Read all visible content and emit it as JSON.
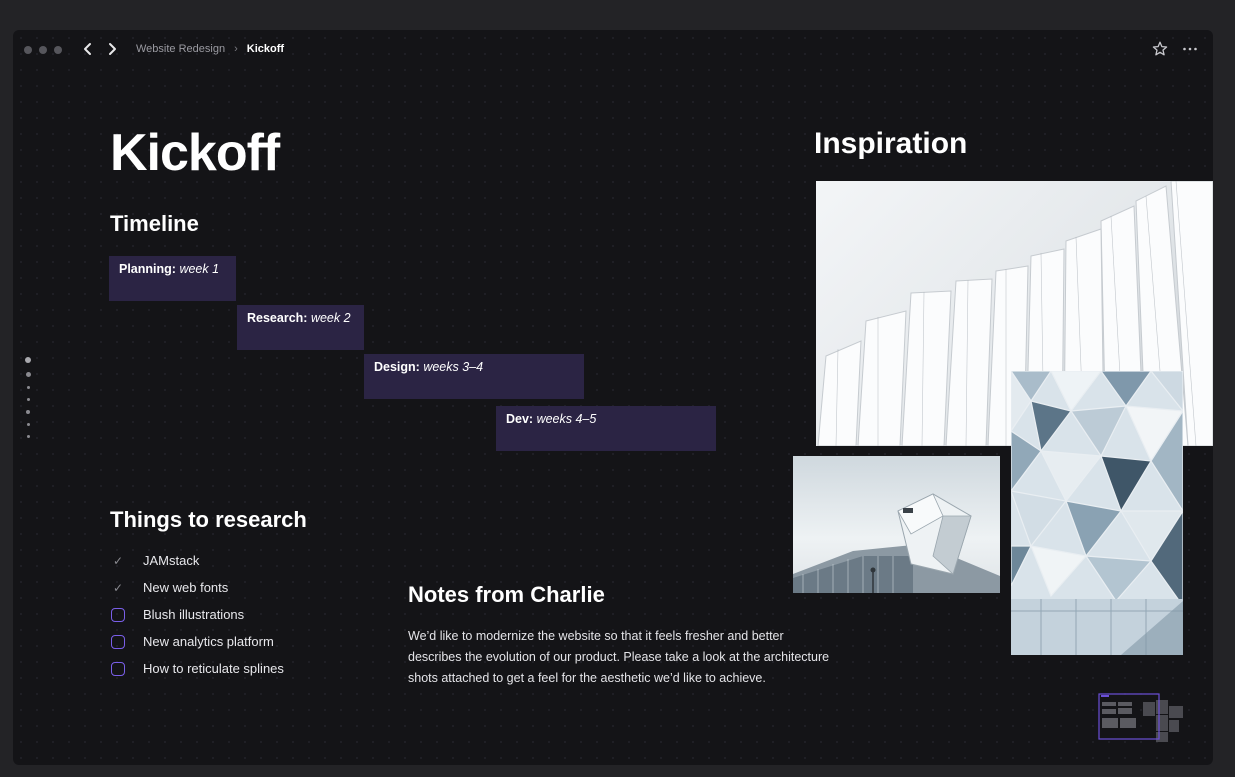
{
  "window": {
    "breadcrumb": {
      "parent": "Website Redesign",
      "separator": "›",
      "current": "Kickoff"
    }
  },
  "page": {
    "title": "Kickoff"
  },
  "timeline": {
    "heading": "Timeline",
    "phases": [
      {
        "label": "Planning:",
        "duration": "week 1"
      },
      {
        "label": "Research:",
        "duration": "week 2"
      },
      {
        "label": "Design:",
        "duration": "weeks 3–4"
      },
      {
        "label": "Dev:",
        "duration": "weeks 4–5"
      }
    ]
  },
  "research": {
    "heading": "Things to research",
    "items": [
      {
        "text": "JAMstack",
        "done": true
      },
      {
        "text": "New web fonts",
        "done": true
      },
      {
        "text": "Blush illustrations",
        "done": false
      },
      {
        "text": "New analytics platform",
        "done": false
      },
      {
        "text": "How to reticulate splines",
        "done": false
      }
    ]
  },
  "notes": {
    "heading": "Notes from Charlie",
    "lines": [
      "We’d like to modernize the website so that it feels fresher and better",
      "describes the evolution of our product. Please take a look at the architecture",
      "shots attached to get a feel for the aesthetic we’d like to achieve."
    ]
  },
  "inspiration": {
    "heading": "Inspiration"
  },
  "colors": {
    "background": "#141417",
    "timeline_bar": "#2b2444",
    "checkbox_accent": "#7a5fe8",
    "minimap_accent": "#6b4fd8"
  },
  "icons": [
    "back-icon",
    "forward-icon",
    "star-icon",
    "more-icon",
    "check-icon",
    "checkbox-icon"
  ]
}
